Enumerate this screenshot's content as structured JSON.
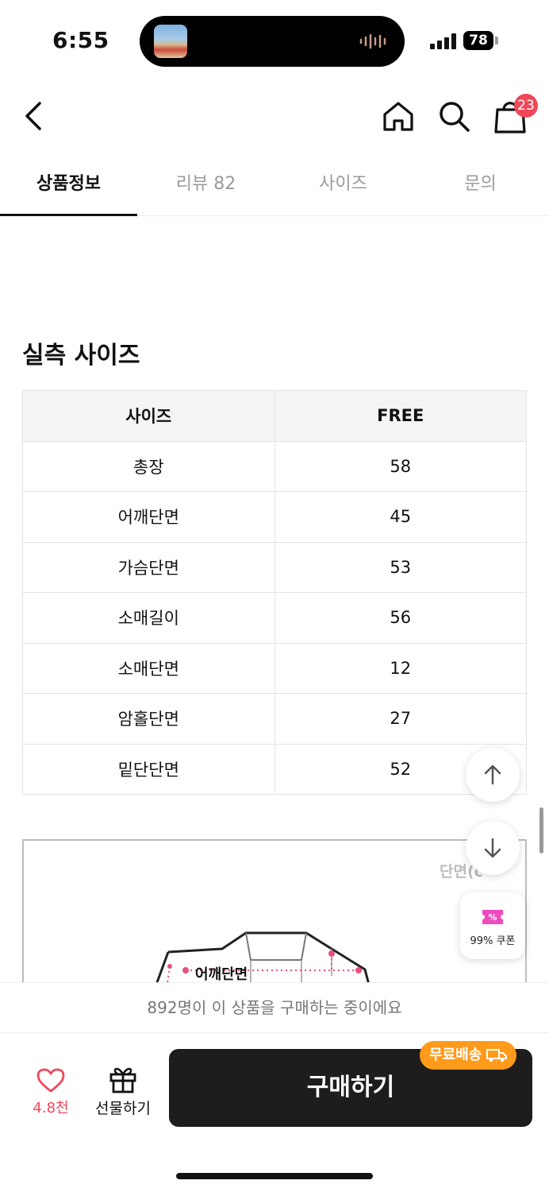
{
  "status": {
    "time": "6:55",
    "battery": "78"
  },
  "nav": {
    "cart_count": "23"
  },
  "tabs": [
    {
      "label": "상품정보"
    },
    {
      "label": "리뷰 82"
    },
    {
      "label": "사이즈"
    },
    {
      "label": "문의"
    }
  ],
  "section": {
    "title": "실측 사이즈"
  },
  "size_table": {
    "headers": [
      "사이즈",
      "FREE"
    ],
    "rows": [
      [
        "총장",
        "58"
      ],
      [
        "어깨단면",
        "45"
      ],
      [
        "가슴단면",
        "53"
      ],
      [
        "소매길이",
        "56"
      ],
      [
        "소매단면",
        "12"
      ],
      [
        "암홀단면",
        "27"
      ],
      [
        "밑단단면",
        "52"
      ]
    ]
  },
  "diagram": {
    "corner_label": "단면(c",
    "shoulder_label": "어깨단면"
  },
  "coupon": {
    "label": "99% 쿠폰"
  },
  "buying_notice": "892명이 이 상품을 구매하는 중이에요",
  "bottom": {
    "like_count": "4.8천",
    "gift_label": "선물하기",
    "buy_label": "구매하기",
    "free_shipping": "무료배송"
  },
  "colors": {
    "accent_red": "#f0485a",
    "badge_orange": "#ff9a1a",
    "button_dark": "#1d1d1d"
  }
}
